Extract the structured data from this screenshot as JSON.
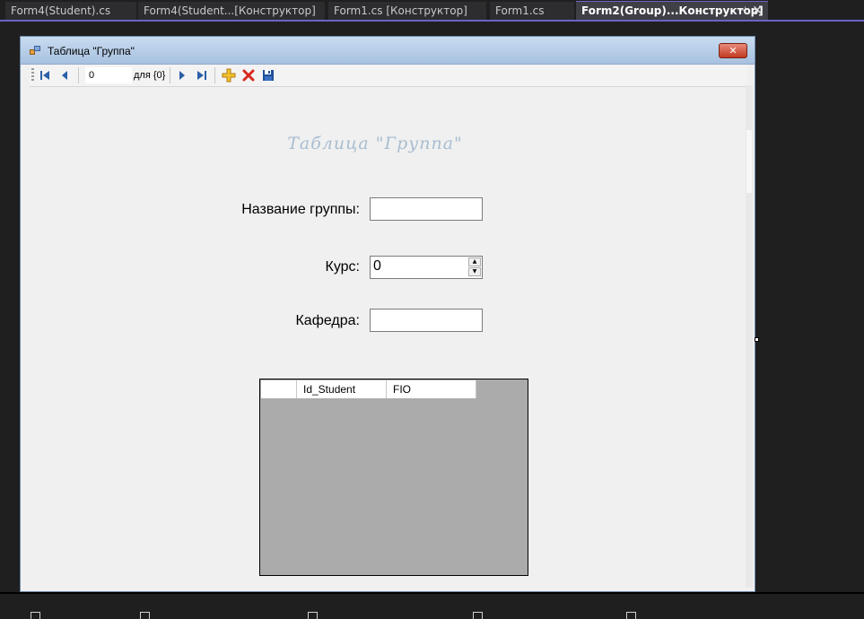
{
  "ide": {
    "tabs": [
      {
        "label": "Form4(Student).cs",
        "active": false
      },
      {
        "label": "Form4(Student...[Конструктор]",
        "active": false
      },
      {
        "label": "Form1.cs [Конструктор]",
        "active": false
      },
      {
        "label": "Form1.cs",
        "active": false
      },
      {
        "label": "Form2(Group)...Конструктор]",
        "active": true
      }
    ],
    "pin_glyph": "⊣",
    "close_glyph": "✕"
  },
  "form": {
    "title": "Таблица \"Группа\"",
    "close_glyph": "✕",
    "navigator": {
      "position": "0",
      "count_text": "для {0}",
      "icons": [
        "move-first-icon",
        "move-previous-icon",
        "move-next-icon",
        "move-last-icon",
        "add-new-icon",
        "delete-icon",
        "save-icon"
      ]
    },
    "heading": "Таблица \"Группа\"",
    "fields": {
      "group_name_label": "Название группы:",
      "group_name_value": "",
      "course_label": "Курс:",
      "course_value": "0",
      "department_label": "Кафедра:",
      "department_value": ""
    },
    "grid": {
      "columns": [
        "Id_Student",
        "FIO"
      ]
    }
  },
  "colors": {
    "ide_background": "#1f1f1f",
    "active_tab_accent": "#6b63c7",
    "form_background": "#f0f0f0",
    "grid_background": "#ababab",
    "heading_color": "#a8bdd0"
  }
}
